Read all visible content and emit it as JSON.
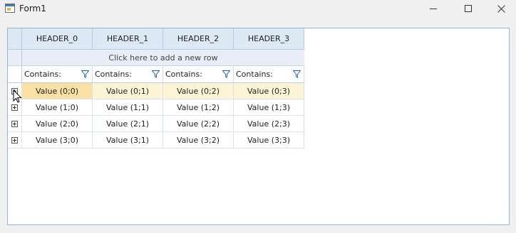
{
  "window": {
    "title": "Form1",
    "icons": {
      "app": "form-app-icon",
      "minimize": "minimize-icon",
      "maximize": "maximize-icon",
      "close": "close-icon"
    }
  },
  "grid": {
    "columns": [
      "HEADER_0",
      "HEADER_1",
      "HEADER_2",
      "HEADER_3"
    ],
    "new_row_text": "Click here to add a new row",
    "filter": [
      "Contains:",
      "Contains:",
      "Contains:",
      "Contains:"
    ],
    "rows": [
      [
        "Value (0;0)",
        "Value (0;1)",
        "Value (0;2)",
        "Value (0;3)"
      ],
      [
        "Value (1;0)",
        "Value (1;1)",
        "Value (1;2)",
        "Value (1;3)"
      ],
      [
        "Value (2;0)",
        "Value (2;1)",
        "Value (2;2)",
        "Value (2;3)"
      ],
      [
        "Value (3;0)",
        "Value (3;1)",
        "Value (3;2)",
        "Value (3;3)"
      ]
    ],
    "row_icon": "expand-plus-icon",
    "filter_icon": "filter-funnel-icon",
    "selected_row": 0,
    "focused_cell": [
      0,
      0
    ]
  },
  "colors": {
    "header_bg": "#dde8f5",
    "selected_row_bg": "#fdf5d6",
    "focused_cell_bg": "#fbe0a4",
    "border": "#9ab4d4"
  }
}
